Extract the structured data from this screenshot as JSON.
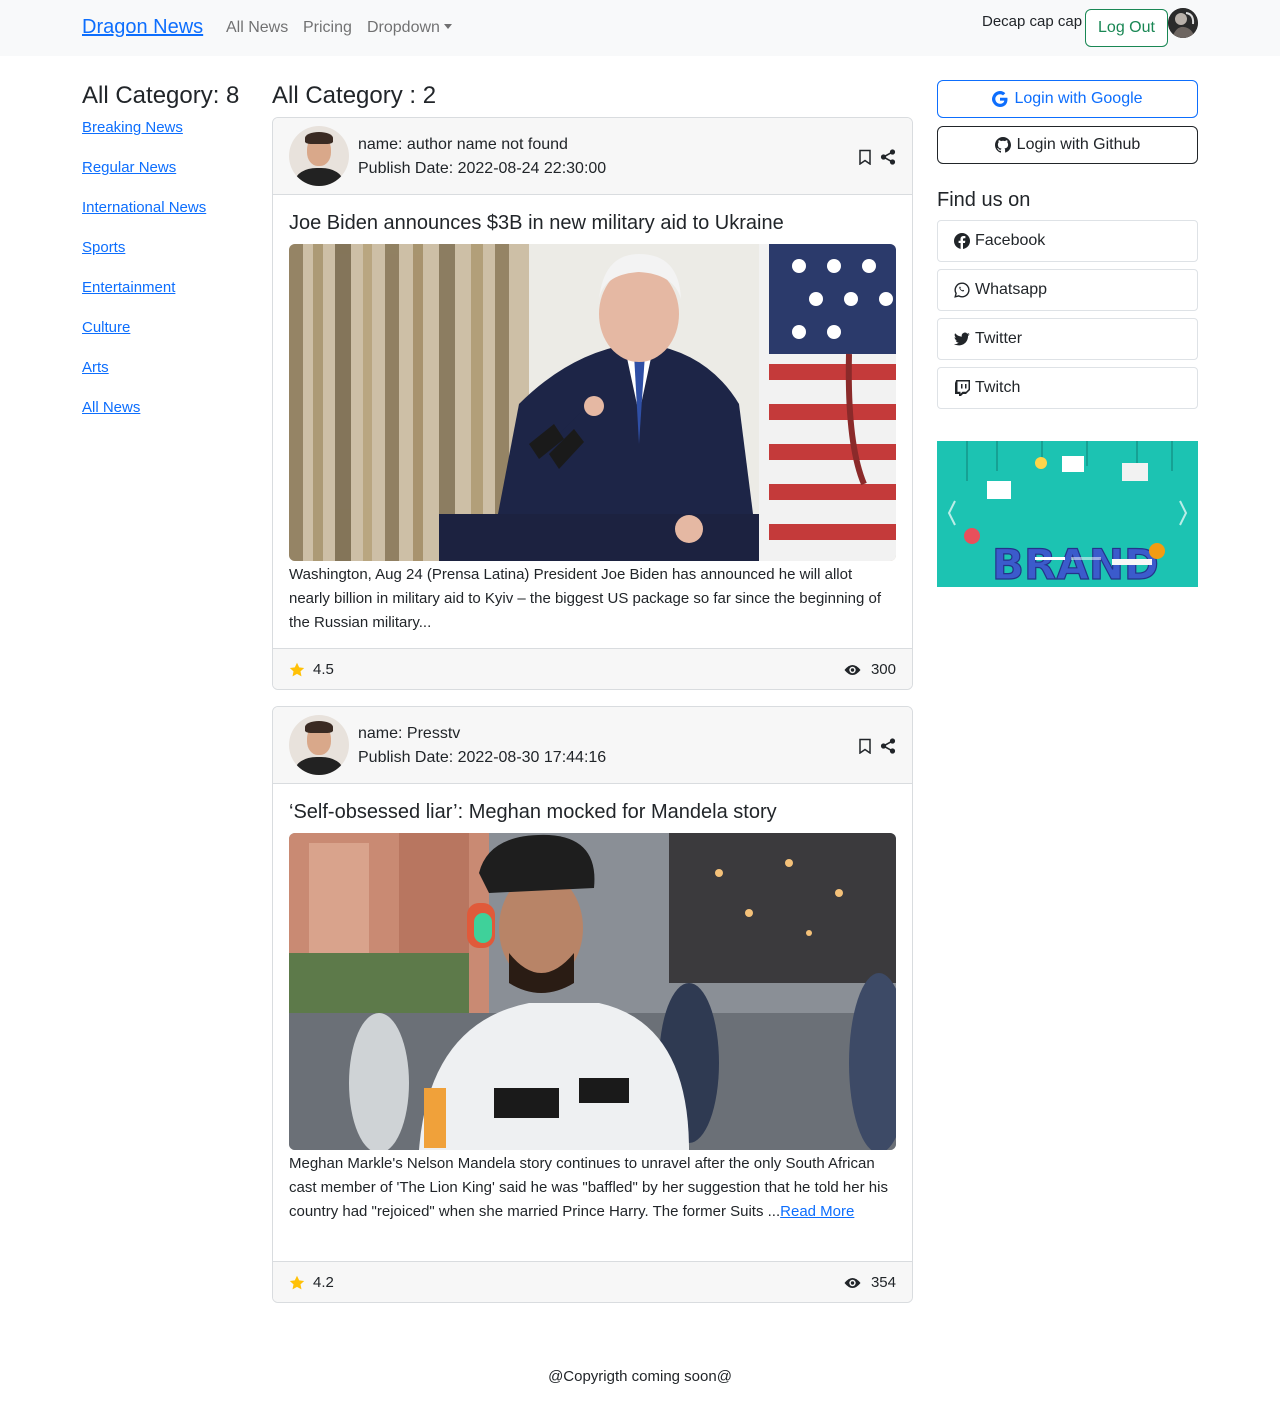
{
  "navbar": {
    "brand": "Dragon News",
    "links": [
      "All News",
      "Pricing",
      "Dropdown"
    ],
    "user_name": "Decap cap cap",
    "logout_label": "Log Out"
  },
  "sidebar_left": {
    "title": "All Category: 8",
    "categories": [
      "Breaking News",
      "Regular News",
      "International News",
      "Sports",
      "Entertainment",
      "Culture",
      "Arts",
      "All News"
    ]
  },
  "main": {
    "title": "All Category : 2",
    "news": [
      {
        "author": "name: author name not found",
        "date": "Publish Date: 2022-08-24 22:30:00",
        "title": "Joe Biden announces $3B in new military aid to Ukraine",
        "details": "Washington, Aug 24 (Prensa Latina) President Joe Biden has announced he will allot nearly billion in military aid to Kyiv – the biggest US package so far since the beginning of the Russian military...",
        "read_more": "",
        "rating": "4.5",
        "views": "300"
      },
      {
        "author": "name: Presstv",
        "date": "Publish Date: 2022-08-30 17:44:16",
        "title": "‘Self-obsessed liar’: Meghan mocked for Mandela story",
        "details": "Meghan Markle's Nelson Mandela story continues to unravel after the only South African cast member of 'The Lion King' said he was \"baffled\" by her suggestion that he told her his country had \"rejoiced\" when she married Prince Harry. The former Suits ...",
        "read_more": "Read More",
        "rating": "4.2",
        "views": "354"
      }
    ]
  },
  "sidebar_right": {
    "google_label": "Login with Google",
    "github_label": "Login with Github",
    "find_title": "Find us on",
    "social": [
      "Facebook",
      "Whatsapp",
      "Twitter",
      "Twitch"
    ],
    "banner_word": "BRAND"
  },
  "footer": {
    "text": "@Copyrigth coming soon@"
  },
  "colors": {
    "primary": "#0d6efd",
    "success": "#198754",
    "star": "#ffc107",
    "banner": "#19c2b4"
  }
}
